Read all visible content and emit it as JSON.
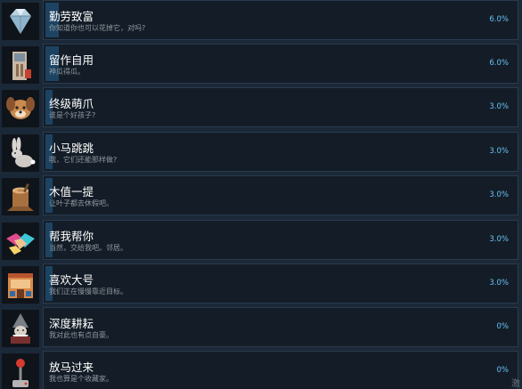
{
  "achievements": [
    {
      "title": "勤劳致富",
      "desc": "你知道你也可以花掉它，对吗?",
      "pct": "6.0%",
      "progress": 0.06,
      "icon": "diamond-icon"
    },
    {
      "title": "留作自用",
      "desc": "神瓜得瓜。",
      "pct": "6.0%",
      "progress": 0.06,
      "icon": "building-icon"
    },
    {
      "title": "终级萌爪",
      "desc": "谁是个好孩子?",
      "pct": "3.0%",
      "progress": 0.03,
      "icon": "dog-icon"
    },
    {
      "title": "小马跳跳",
      "desc": "哦，它们还能那样做?",
      "pct": "3.0%",
      "progress": 0.03,
      "icon": "rabbit-icon"
    },
    {
      "title": "木值一提",
      "desc": "让叶子都去休假吧。",
      "pct": "3.0%",
      "progress": 0.03,
      "icon": "stump-icon"
    },
    {
      "title": "帮我帮你",
      "desc": "当然，交给我吧。邻居。",
      "pct": "3.0%",
      "progress": 0.03,
      "icon": "handshake-icon"
    },
    {
      "title": "喜欢大号",
      "desc": "我们正在慢慢靠近目标。",
      "pct": "3.0%",
      "progress": 0.03,
      "icon": "house-icon"
    },
    {
      "title": "深度耕耘",
      "desc": "我对此也有点自豪。",
      "pct": "0%",
      "progress": 0.0,
      "icon": "gnome-icon"
    },
    {
      "title": "放马过来",
      "desc": "我也算是个收藏家。",
      "pct": "0%",
      "progress": 0.0,
      "icon": "joystick-icon"
    }
  ],
  "corner_text": "激"
}
